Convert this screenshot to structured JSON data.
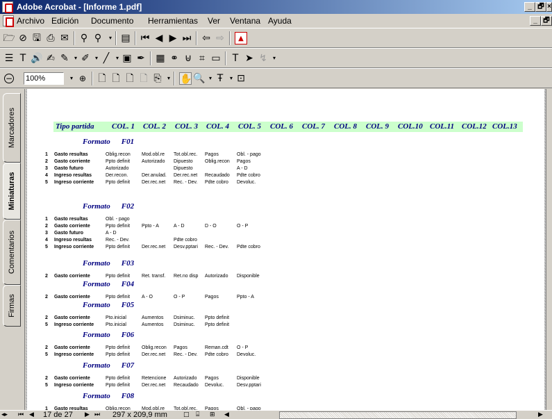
{
  "window": {
    "title": "Adobe Acrobat - [Informe 1.pdf]",
    "min": "_",
    "max": "🗗",
    "close": "×"
  },
  "menu": {
    "items": [
      "Archivo",
      "Edición",
      "Documento",
      "Herramientas",
      "Ver",
      "Ventana",
      "Ayuda"
    ]
  },
  "toolbar1": {
    "icons": [
      "open-icon",
      "save-online-icon",
      "save-icon",
      "print-icon",
      "email-icon",
      "find-icon",
      "search-icon",
      "dropdown",
      "navigation-pane-icon",
      "first-page-icon",
      "previous-page-icon",
      "next-page-icon",
      "last-page-icon",
      "go-back-icon",
      "go-forward-icon",
      "adobe-logo-icon"
    ]
  },
  "toolbar2": {
    "icons": [
      "text-select-icon",
      "touchup-text-icon",
      "sound-icon",
      "stamp-icon",
      "highlight-icon",
      "pencil-icon",
      "line-icon",
      "form-icon",
      "signature-icon",
      "movie-icon",
      "link-icon",
      "article-icon",
      "crop-icon",
      "thread-icon",
      "type-icon",
      "cursor-icon",
      "annotation-icon"
    ]
  },
  "toolbar3": {
    "zoom_value": "100%",
    "icons": [
      "zoom-out-icon",
      "zoom-in-icon",
      "actual-size-icon",
      "fit-page-icon",
      "fit-width-icon",
      "fit-visible-icon",
      "rotate-icon",
      "hand-tool-icon",
      "zoom-tool-icon",
      "text-select-icon",
      "graphics-select-icon"
    ]
  },
  "nav_tabs": [
    "Marcadores",
    "Miniaturas",
    "Comentarios",
    "Firmas"
  ],
  "header": {
    "first": "Tipo partida",
    "cols": [
      "COL. 1",
      "COL. 2",
      "COL. 3",
      "COL. 4",
      "COL. 5",
      "COL. 6",
      "COL. 7",
      "COL. 8",
      "COL. 9",
      "COL.10",
      "COL.11",
      "COL.12",
      "COL.13"
    ]
  },
  "formato_label": "Formato",
  "sections": [
    {
      "code": "F01",
      "rows": [
        {
          "n": "1",
          "cat": "Gasto resultas",
          "cells": [
            "Oblig.recon",
            "Mod.obl.re",
            "Tot.obl.rec.",
            "Pagos",
            "Obl. - pago"
          ]
        },
        {
          "n": "2",
          "cat": "Gasto corriente",
          "cells": [
            "Ppto definit",
            "Autorizado",
            "Dipuesto",
            "Oblig.recon",
            "Pagos"
          ]
        },
        {
          "n": "3",
          "cat": "Gasto futuro",
          "cells": [
            "Autorizado",
            "",
            "Dipuesto",
            "",
            "A - D"
          ]
        },
        {
          "n": "4",
          "cat": "Ingreso resultas",
          "cells": [
            "Der.recon.",
            "Der.anulad.",
            "Der.rec.net",
            "Recaudado",
            "Pdte cobro"
          ]
        },
        {
          "n": "5",
          "cat": "Ingreso corriente",
          "cells": [
            "Ppto definit",
            "Der.rec.net",
            "Rec. - Dev.",
            "Pdte cobro",
            "Devoluc."
          ]
        }
      ]
    },
    {
      "code": "F02",
      "rows": [
        {
          "n": "1",
          "cat": "Gasto resultas",
          "cells": [
            "Obl. - pago",
            "",
            "",
            "",
            ""
          ]
        },
        {
          "n": "2",
          "cat": "Gasto corriente",
          "cells": [
            "Ppto definit",
            "Ppto - A",
            "A - D",
            "D - O",
            "O - P"
          ]
        },
        {
          "n": "3",
          "cat": "Gasto futuro",
          "cells": [
            "A - D",
            "",
            "",
            "",
            ""
          ]
        },
        {
          "n": "4",
          "cat": "Ingreso resultas",
          "cells": [
            "Rec. - Dev.",
            "",
            "Pdte cobro",
            "",
            ""
          ]
        },
        {
          "n": "5",
          "cat": "Ingreso corriente",
          "cells": [
            "Ppto definit",
            "Der.rec.net",
            "Desv.pptari",
            "Rec. - Dev.",
            "Pdte cobro"
          ]
        }
      ]
    },
    {
      "code": "F03",
      "rows": [
        {
          "n": "2",
          "cat": "Gasto corriente",
          "cells": [
            "Ppto definit",
            "Ret. transf.",
            "Ret.no disp",
            "Autorizado",
            "Disponible"
          ]
        }
      ]
    },
    {
      "code": "F04",
      "rows": [
        {
          "n": "2",
          "cat": "Gasto corriente",
          "cells": [
            "Ppto definit",
            "A - O",
            "O - P",
            "Pagos",
            "Ppto - A"
          ]
        }
      ]
    },
    {
      "code": "F05",
      "rows": [
        {
          "n": "2",
          "cat": "Gasto corriente",
          "cells": [
            "Pto.inicial",
            "Aumentos",
            "Dsiminuc.",
            "Ppto definit",
            ""
          ]
        },
        {
          "n": "5",
          "cat": "Ingreso corriente",
          "cells": [
            "Pto.inicial",
            "Aumentos",
            "Dsiminuc.",
            "Ppto definit",
            ""
          ]
        }
      ]
    },
    {
      "code": "F06",
      "rows": [
        {
          "n": "2",
          "cat": "Gasto corriente",
          "cells": [
            "Ppto definit",
            "Oblig.recon",
            "Pagos",
            "Reman.cdt",
            "O - P"
          ]
        },
        {
          "n": "5",
          "cat": "Ingreso corriente",
          "cells": [
            "Ppto definit",
            "Der.rec.net",
            "Rec. - Dev.",
            "Pdte cobro",
            "Devoluc."
          ]
        }
      ]
    },
    {
      "code": "F07",
      "rows": [
        {
          "n": "2",
          "cat": "Gasto corriente",
          "cells": [
            "Ppto definit",
            "Retencione",
            "Autorizado",
            "Pagos",
            "Disponible"
          ]
        },
        {
          "n": "5",
          "cat": "Ingreso corriente",
          "cells": [
            "Ppto definit",
            "Der.rec.net",
            "Recaudado",
            "Devoluc.",
            "Desv.pptari"
          ]
        }
      ]
    },
    {
      "code": "F08",
      "rows": [
        {
          "n": "1",
          "cat": "Gasto resultas",
          "cells": [
            "Oblig.recon",
            "Mod.obl.re",
            "Tot.obl.rec.",
            "Pagos",
            "Obl. - pago"
          ]
        }
      ]
    }
  ],
  "status": {
    "page": "17 de 27",
    "size": "297 x 209,9  mm"
  }
}
